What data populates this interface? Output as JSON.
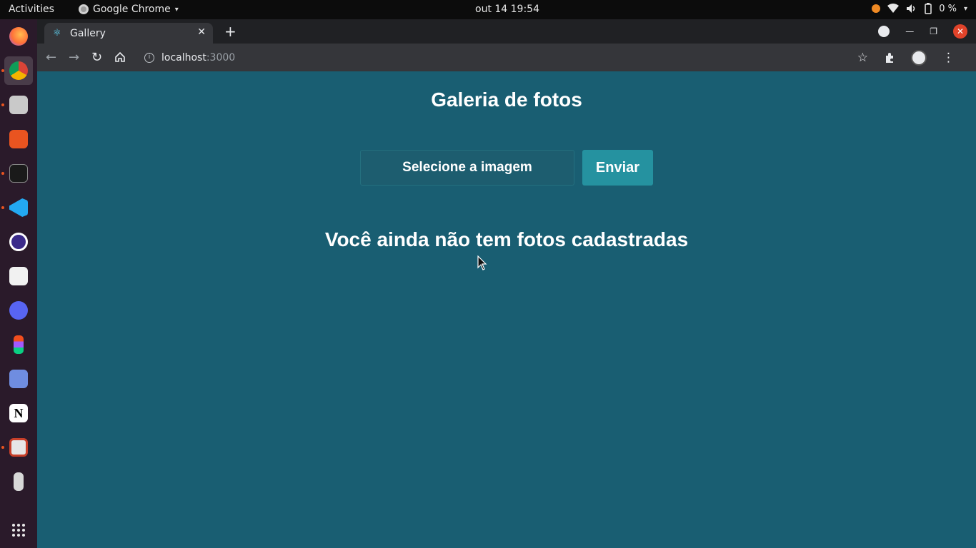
{
  "system_bar": {
    "activities": "Activities",
    "app_name": "Google Chrome",
    "clock": "out 14  19:54",
    "battery": "0 %"
  },
  "dock": {
    "items": [
      "firefox-icon",
      "chrome-icon",
      "files-icon",
      "software-icon",
      "terminal-icon",
      "vscode-icon",
      "eclipse-icon",
      "inkscape-icon",
      "discord-icon",
      "figma-icon",
      "screenshot-icon",
      "notion-icon",
      "archive-icon",
      "usb-icon",
      "app-grid-icon"
    ]
  },
  "browser": {
    "tab_title": "Gallery",
    "new_tab": "+",
    "url_host": "localhost",
    "url_port": ":3000"
  },
  "page": {
    "title": "Galeria de fotos",
    "file_input_label": "Selecione a imagem",
    "submit_label": "Enviar",
    "empty_message": "Você ainda não tem fotos cadastradas"
  },
  "colors": {
    "page_bg": "#195e72",
    "button_bg": "#2592a0"
  }
}
